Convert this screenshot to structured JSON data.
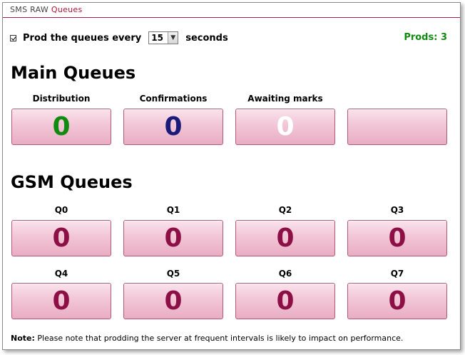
{
  "title": {
    "prefix": "SMS RAW ",
    "accent": "Queues"
  },
  "controls": {
    "prod_label": "Prod the queues every",
    "interval_value": "15",
    "seconds_label": "seconds",
    "prods_text": "Prods: 3"
  },
  "main": {
    "heading": "Main Queues",
    "queues": [
      {
        "label": "Distribution",
        "value": "0",
        "color": "#118a11"
      },
      {
        "label": "Confirmations",
        "value": "0",
        "color": "#1a1a7a"
      },
      {
        "label": "Awaiting marks",
        "value": "0",
        "color": "#ffffff"
      },
      {
        "label": "",
        "value": "",
        "color": "#8c0f45"
      }
    ]
  },
  "gsm": {
    "heading": "GSM Queues",
    "queues": [
      {
        "label": "Q0",
        "value": "0"
      },
      {
        "label": "Q1",
        "value": "0"
      },
      {
        "label": "Q2",
        "value": "0"
      },
      {
        "label": "Q3",
        "value": "0"
      },
      {
        "label": "Q4",
        "value": "0"
      },
      {
        "label": "Q5",
        "value": "0"
      },
      {
        "label": "Q6",
        "value": "0"
      },
      {
        "label": "Q7",
        "value": "0"
      }
    ],
    "value_color": "#8c0f45"
  },
  "note": {
    "bold": "Note:",
    "text": " Please note that prodding the server at frequent intervals is likely to impact on performance."
  }
}
